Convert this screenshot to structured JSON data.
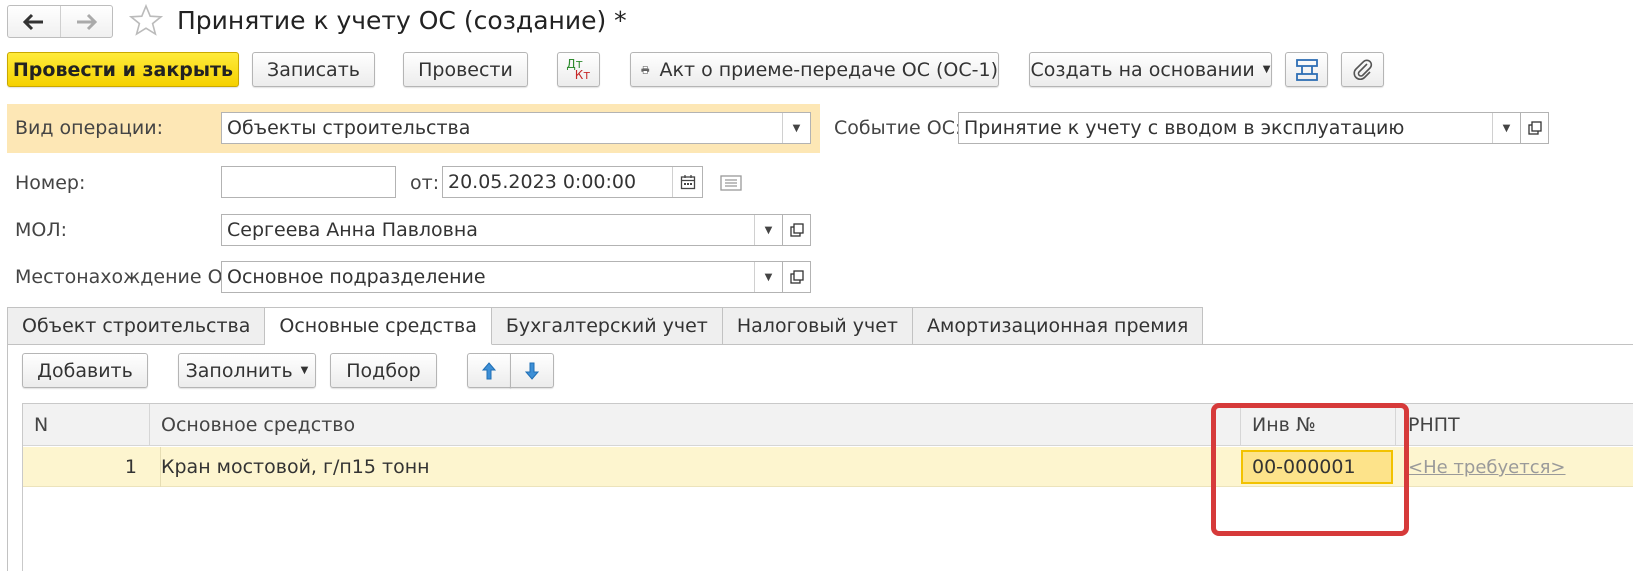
{
  "window": {
    "title": "Принятие к учету ОС (создание) *"
  },
  "toolbar": {
    "post_close_label": "Провести и закрыть",
    "save_label": "Записать",
    "post_label": "Провести",
    "dtkt_top": "Дт",
    "dtkt_bottom": "Кт",
    "print_act_label": "Акт о приеме-передаче ОС (ОС-1)",
    "create_based_label": "Создать на основании"
  },
  "form": {
    "operation_label": "Вид операции:",
    "operation_value": "Объекты строительства",
    "event_label": "Событие ОС:",
    "event_value": "Принятие к учету с вводом в эксплуатацию",
    "number_label": "Номер:",
    "number_value": "",
    "date_label": "от:",
    "date_value": "20.05.2023  0:00:00",
    "mol_label": "МОЛ:",
    "mol_value": "Сергеева Анна Павловна",
    "location_label": "Местонахождение ОС:",
    "location_value": "Основное подразделение"
  },
  "tabs": [
    {
      "label": "Объект строительства"
    },
    {
      "label": "Основные средства"
    },
    {
      "label": "Бухгалтерский учет"
    },
    {
      "label": "Налоговый учет"
    },
    {
      "label": "Амортизационная премия"
    }
  ],
  "table_toolbar": {
    "add_label": "Добавить",
    "fill_label": "Заполнить",
    "select_label": "Подбор"
  },
  "table": {
    "columns": [
      "N",
      "Основное средство",
      "Инв №",
      "РНПТ"
    ],
    "rows": [
      {
        "n": "1",
        "asset": "Кран мостовой, г/п15 тонн",
        "inv": "00-000001",
        "rnpt": "<Не требуется>"
      }
    ]
  },
  "colors": {
    "primary_button": "#f5d100",
    "operation_band": "#fde7b5",
    "selected_row": "#fdf5cf",
    "highlight_box": "#d63a3a"
  }
}
